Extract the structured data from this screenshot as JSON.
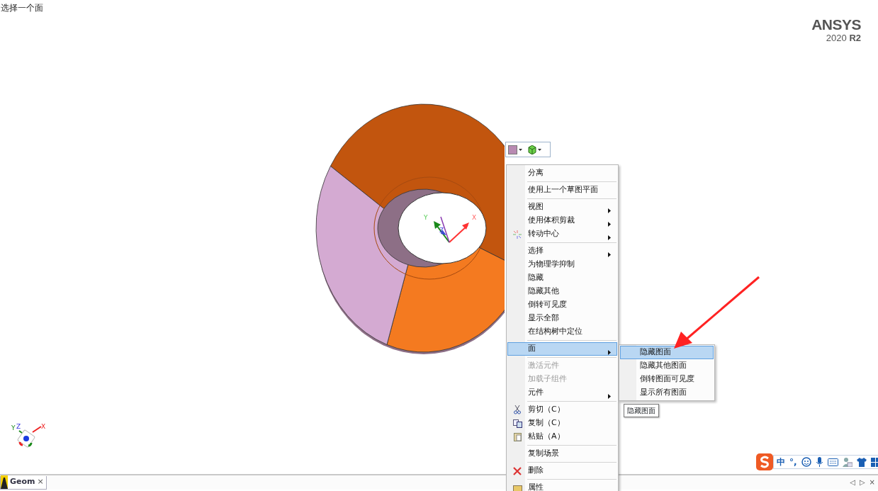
{
  "status_text": "选择一个面",
  "logo": {
    "name": "ANSYS",
    "version": "2020 **R2**"
  },
  "context_menu": {
    "items": [
      {
        "kind": "item",
        "label": "分离",
        "has_submenu": false,
        "disabled": false,
        "selected": false,
        "has_icon": false
      },
      {
        "kind": "separator"
      },
      {
        "kind": "item",
        "label": "使用上一个草图平面",
        "has_submenu": false,
        "disabled": false,
        "selected": false,
        "has_icon": false
      },
      {
        "kind": "separator"
      },
      {
        "kind": "item",
        "label": "视图",
        "has_submenu": true,
        "disabled": false,
        "selected": false,
        "has_icon": false
      },
      {
        "kind": "item",
        "label": "使用体积剪裁",
        "has_submenu": true,
        "disabled": false,
        "selected": false,
        "has_icon": false
      },
      {
        "kind": "item",
        "label": "转动中心",
        "has_submenu": true,
        "disabled": false,
        "selected": false,
        "has_icon": true
      },
      {
        "kind": "separator"
      },
      {
        "kind": "item",
        "label": "选择",
        "has_submenu": true,
        "disabled": false,
        "selected": false,
        "has_icon": false
      },
      {
        "kind": "item",
        "label": "为物理学抑制",
        "has_submenu": false,
        "disabled": false,
        "selected": false,
        "has_icon": false
      },
      {
        "kind": "item",
        "label": "隐藏",
        "has_submenu": false,
        "disabled": false,
        "selected": false,
        "has_icon": false
      },
      {
        "kind": "item",
        "label": "隐藏其他",
        "has_submenu": false,
        "disabled": false,
        "selected": false,
        "has_icon": false
      },
      {
        "kind": "item",
        "label": "倒转可见度",
        "has_submenu": false,
        "disabled": false,
        "selected": false,
        "has_icon": false
      },
      {
        "kind": "item",
        "label": "显示全部",
        "has_submenu": false,
        "disabled": false,
        "selected": false,
        "has_icon": false
      },
      {
        "kind": "item",
        "label": "在结构树中定位",
        "has_submenu": false,
        "disabled": false,
        "selected": false,
        "has_icon": false
      },
      {
        "kind": "separator"
      },
      {
        "kind": "item",
        "label": "面",
        "has_submenu": true,
        "disabled": false,
        "selected": true,
        "has_icon": false
      },
      {
        "kind": "separator"
      },
      {
        "kind": "item",
        "label": "激活元件",
        "has_submenu": false,
        "disabled": true,
        "selected": false,
        "has_icon": false
      },
      {
        "kind": "item",
        "label": "加载子组件",
        "has_submenu": false,
        "disabled": true,
        "selected": false,
        "has_icon": false
      },
      {
        "kind": "item",
        "label": "元件",
        "has_submenu": true,
        "disabled": false,
        "selected": false,
        "has_icon": false
      },
      {
        "kind": "separator"
      },
      {
        "kind": "item",
        "label": "剪切（C）",
        "has_submenu": false,
        "disabled": false,
        "selected": false,
        "has_icon": true
      },
      {
        "kind": "item",
        "label": "复制（C）",
        "has_submenu": false,
        "disabled": false,
        "selected": false,
        "has_icon": true
      },
      {
        "kind": "item",
        "label": "粘贴（A）",
        "has_submenu": false,
        "disabled": false,
        "selected": false,
        "has_icon": true
      },
      {
        "kind": "separator"
      },
      {
        "kind": "item",
        "label": "复制场景",
        "has_submenu": false,
        "disabled": false,
        "selected": false,
        "has_icon": false
      },
      {
        "kind": "separator"
      },
      {
        "kind": "item",
        "label": "删除",
        "has_submenu": false,
        "disabled": false,
        "selected": false,
        "has_icon": true
      },
      {
        "kind": "separator"
      },
      {
        "kind": "item",
        "label": "属性",
        "has_submenu": false,
        "disabled": false,
        "selected": false,
        "has_icon": true
      }
    ]
  },
  "submenu": {
    "items": [
      {
        "label": "隐藏图面",
        "selected": true
      },
      {
        "label": "隐藏其他图面",
        "selected": false
      },
      {
        "label": "倒转图面可见度",
        "selected": false
      },
      {
        "label": "显示所有图面",
        "selected": false
      }
    ]
  },
  "tooltip": "隐藏图面",
  "axis_labels": {
    "x": "X",
    "y": "Y",
    "z": "Z"
  },
  "triad_labels": {
    "x": "X",
    "y": "Y",
    "z": "Z"
  },
  "ime_toolbar": {
    "mode": "中",
    "punctuation": "°,"
  },
  "tabs": [
    {
      "label": "Geom",
      "selected": true,
      "close": "×"
    }
  ],
  "tab_nav": {
    "prev": "◁",
    "next": "▷",
    "close": "×"
  }
}
